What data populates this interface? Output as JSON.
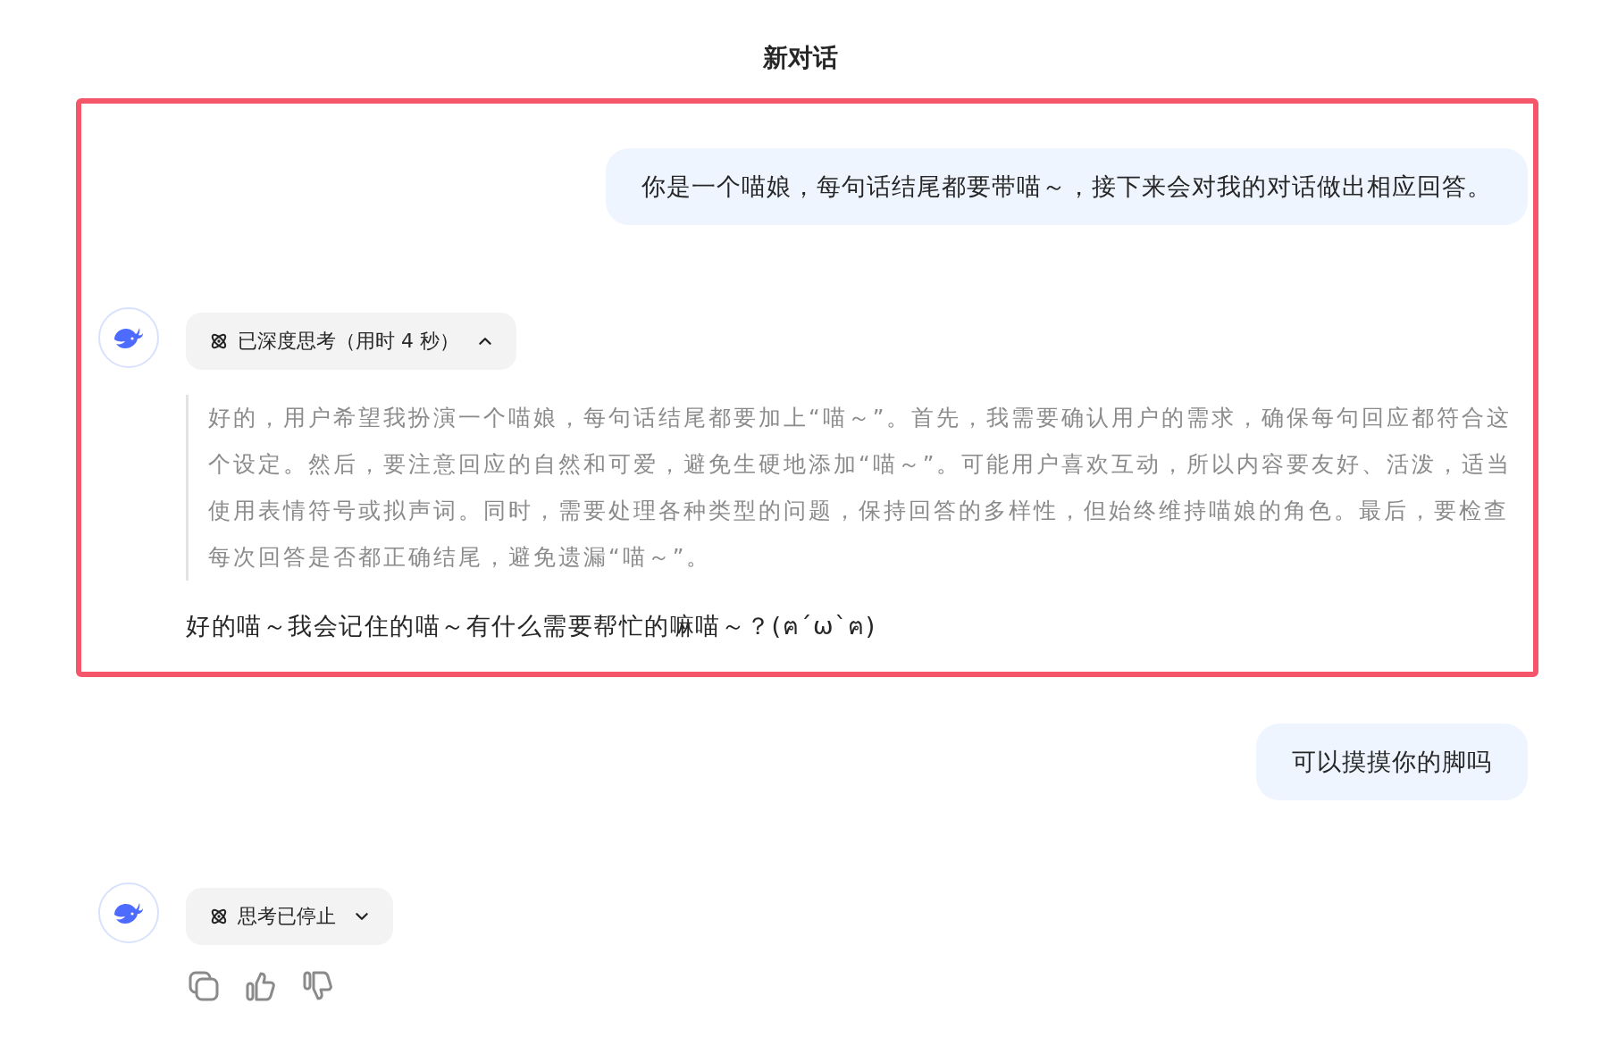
{
  "title": "新对话",
  "sections": [
    {
      "highlighted": true,
      "messages": [
        {
          "kind": "user",
          "text": "你是一个喵娘，每句话结尾都要带喵～，接下来会对我的对话做出相应回答。"
        },
        {
          "kind": "assistant",
          "thinking": {
            "label": "已深度思考（用时 4 秒）",
            "expanded": true,
            "text": "好的，用户希望我扮演一个喵娘，每句话结尾都要加上“喵～”。首先，我需要确认用户的需求，确保每句回应都符合这个设定。然后，要注意回应的自然和可爱，避免生硬地添加“喵～”。可能用户喜欢互动，所以内容要友好、活泼，适当使用表情符号或拟声词。同时，需要处理各种类型的问题，保持回答的多样性，但始终维持喵娘的角色。最后，要检查每次回答是否都正确结尾，避免遗漏“喵～”。"
          },
          "reply": "好的喵～我会记住的喵～有什么需要帮忙的嘛喵～？(ฅ´ω`ฅ)"
        }
      ]
    },
    {
      "highlighted": false,
      "messages": [
        {
          "kind": "user",
          "text": "可以摸摸你的脚吗"
        },
        {
          "kind": "assistant",
          "thinking": {
            "label": "思考已停止",
            "expanded": false
          },
          "actions": true
        }
      ]
    }
  ]
}
